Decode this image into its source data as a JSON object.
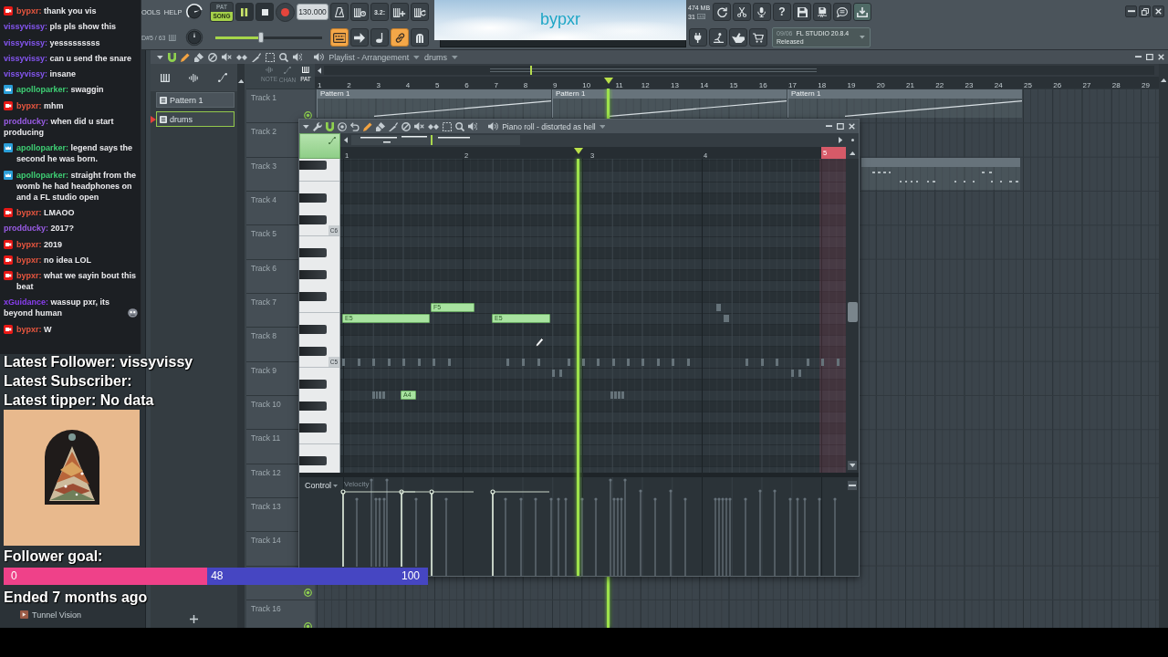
{
  "chat": {
    "messages": [
      {
        "user": "bypxr:",
        "kind": "broadcaster",
        "color": "#e8563f",
        "text": "thank you vis",
        "emote": false
      },
      {
        "user": "vissyvissy:",
        "kind": "viewer",
        "color": "#8455f0",
        "text": "pls pls show this",
        "emote": false
      },
      {
        "user": "vissyvissy:",
        "kind": "viewer",
        "color": "#8455f0",
        "text": "yesssssssss",
        "emote": false
      },
      {
        "user": "vissyvissy:",
        "kind": "viewer",
        "color": "#8455f0",
        "text": "can u send the snare",
        "emote": false
      },
      {
        "user": "vissyvissy:",
        "kind": "viewer",
        "color": "#8455f0",
        "text": "insane",
        "emote": false
      },
      {
        "user": "apolloparker:",
        "kind": "subscriber",
        "color": "#3ecf74",
        "text": "swaggin",
        "emote": false
      },
      {
        "user": "bypxr:",
        "kind": "broadcaster",
        "color": "#e8563f",
        "text": "mhm",
        "emote": false
      },
      {
        "user": "prodducky:",
        "kind": "viewer",
        "color": "#9a5ce6",
        "text": "when did u start producing",
        "emote": false
      },
      {
        "user": "apolloparker:",
        "kind": "subscriber",
        "color": "#3ecf74",
        "text": "legend says the second he was born.",
        "emote": false
      },
      {
        "user": "apolloparker:",
        "kind": "subscriber",
        "color": "#3ecf74",
        "text": "straight from the womb he had headphones on and a FL studio open",
        "emote": false
      },
      {
        "user": "bypxr:",
        "kind": "broadcaster",
        "color": "#e8563f",
        "text": "LMAOO",
        "emote": false
      },
      {
        "user": "prodducky:",
        "kind": "viewer",
        "color": "#9a5ce6",
        "text": "2017?",
        "emote": false
      },
      {
        "user": "bypxr:",
        "kind": "broadcaster",
        "color": "#e8563f",
        "text": "2019",
        "emote": false
      },
      {
        "user": "bypxr:",
        "kind": "broadcaster",
        "color": "#e8563f",
        "text": "no idea LOL",
        "emote": false
      },
      {
        "user": "bypxr:",
        "kind": "broadcaster",
        "color": "#e8563f",
        "text": "what we sayin bout this beat",
        "emote": false
      },
      {
        "user": "xGuidance:",
        "kind": "viewer",
        "color": "#8a3ff0",
        "text": "wassup pxr, its beyond human",
        "emote": true
      },
      {
        "user": "bypxr:",
        "kind": "broadcaster",
        "color": "#e8563f",
        "text": "W",
        "emote": false
      }
    ]
  },
  "banner": {
    "title": "bypxr"
  },
  "toolbar": {
    "menu": [
      {
        "label": "OOLS"
      },
      {
        "label": "HELP"
      }
    ],
    "readout": "D#5 / 63",
    "knobs": [
      {
        "level": 0.78
      },
      {
        "level": 0.5
      }
    ],
    "modes": [
      {
        "label": "PAT",
        "selected": false
      },
      {
        "label": "SONG",
        "selected": true
      }
    ],
    "playing": true,
    "tempo": "130.000",
    "pitch_slider": {
      "level": 0.43
    },
    "record_buttons": [
      {
        "on": false
      },
      {
        "on": false
      },
      {
        "label": "3.2:",
        "on": false
      },
      {
        "on": false
      },
      {
        "on": false
      }
    ],
    "edit_buttons": [
      {
        "on": true
      },
      {
        "on": false
      },
      {
        "on": false
      },
      {
        "on": true
      },
      {
        "on": false
      }
    ],
    "memory": "474 MB",
    "cpu": "31",
    "help": "?",
    "news": {
      "date": "09/06",
      "title": "FL STUDIO 20.8.4",
      "status": "Released"
    }
  },
  "browser": {
    "items": [
      {
        "name": "Tunnel Vision"
      }
    ]
  },
  "playlist": {
    "title": "Playlist - Arrangement",
    "pattern": "drums",
    "patterns": [
      {
        "name": "Pattern 1",
        "selected": false
      },
      {
        "name": "drums",
        "selected": true
      }
    ],
    "views": [
      {
        "label": "NOTE",
        "selected": false
      },
      {
        "label": "CHAN",
        "selected": false
      },
      {
        "label": "PAT",
        "selected": true
      }
    ],
    "bars": [
      "1",
      "2",
      "3",
      "4",
      "5",
      "6",
      "7",
      "8",
      "9",
      "10",
      "11",
      "12",
      "13",
      "14",
      "15",
      "16",
      "17",
      "18",
      "19",
      "20",
      "21",
      "22",
      "23",
      "24",
      "25",
      "26",
      "27",
      "28",
      "29"
    ],
    "tracks": [
      {
        "name": "Track 1",
        "on": true,
        "clips": [
          {
            "label": "Pattern 1"
          },
          {
            "label": "Pattern 1"
          },
          {
            "label": "Pattern 1"
          }
        ]
      },
      {
        "name": "Track 2"
      },
      {
        "name": "Track 3"
      },
      {
        "name": "Track 4"
      },
      {
        "name": "Track 5"
      },
      {
        "name": "Track 6"
      },
      {
        "name": "Track 7"
      },
      {
        "name": "Track 8"
      },
      {
        "name": "Track 9"
      },
      {
        "name": "Track 10"
      },
      {
        "name": "Track 11"
      },
      {
        "name": "Track 12"
      },
      {
        "name": "Track 13"
      },
      {
        "name": "Track 14"
      },
      {
        "on": true
      },
      {
        "name": "Track 16",
        "on": true
      }
    ]
  },
  "piano_roll": {
    "title": "Piano roll - distorted as hell",
    "bars": [
      "1",
      "2",
      "3",
      "4"
    ],
    "loop_end": "5",
    "key_labels": [
      "C6",
      "C5"
    ],
    "notes": [
      {
        "label": "E5"
      },
      {
        "label": "F5"
      },
      {
        "label": "E5"
      },
      {
        "label": "A4"
      }
    ],
    "control": "Control",
    "parameter": "Velocity"
  },
  "stream_overlay": {
    "lines": [
      "Latest Follower: vissyvissy",
      "Latest Subscriber:",
      "Latest tipper: No data"
    ],
    "goal": {
      "title": "Follower goal:",
      "start": "0",
      "current": "48",
      "target": "100",
      "level": 0.48
    },
    "status": "Ended 7 months ago"
  }
}
